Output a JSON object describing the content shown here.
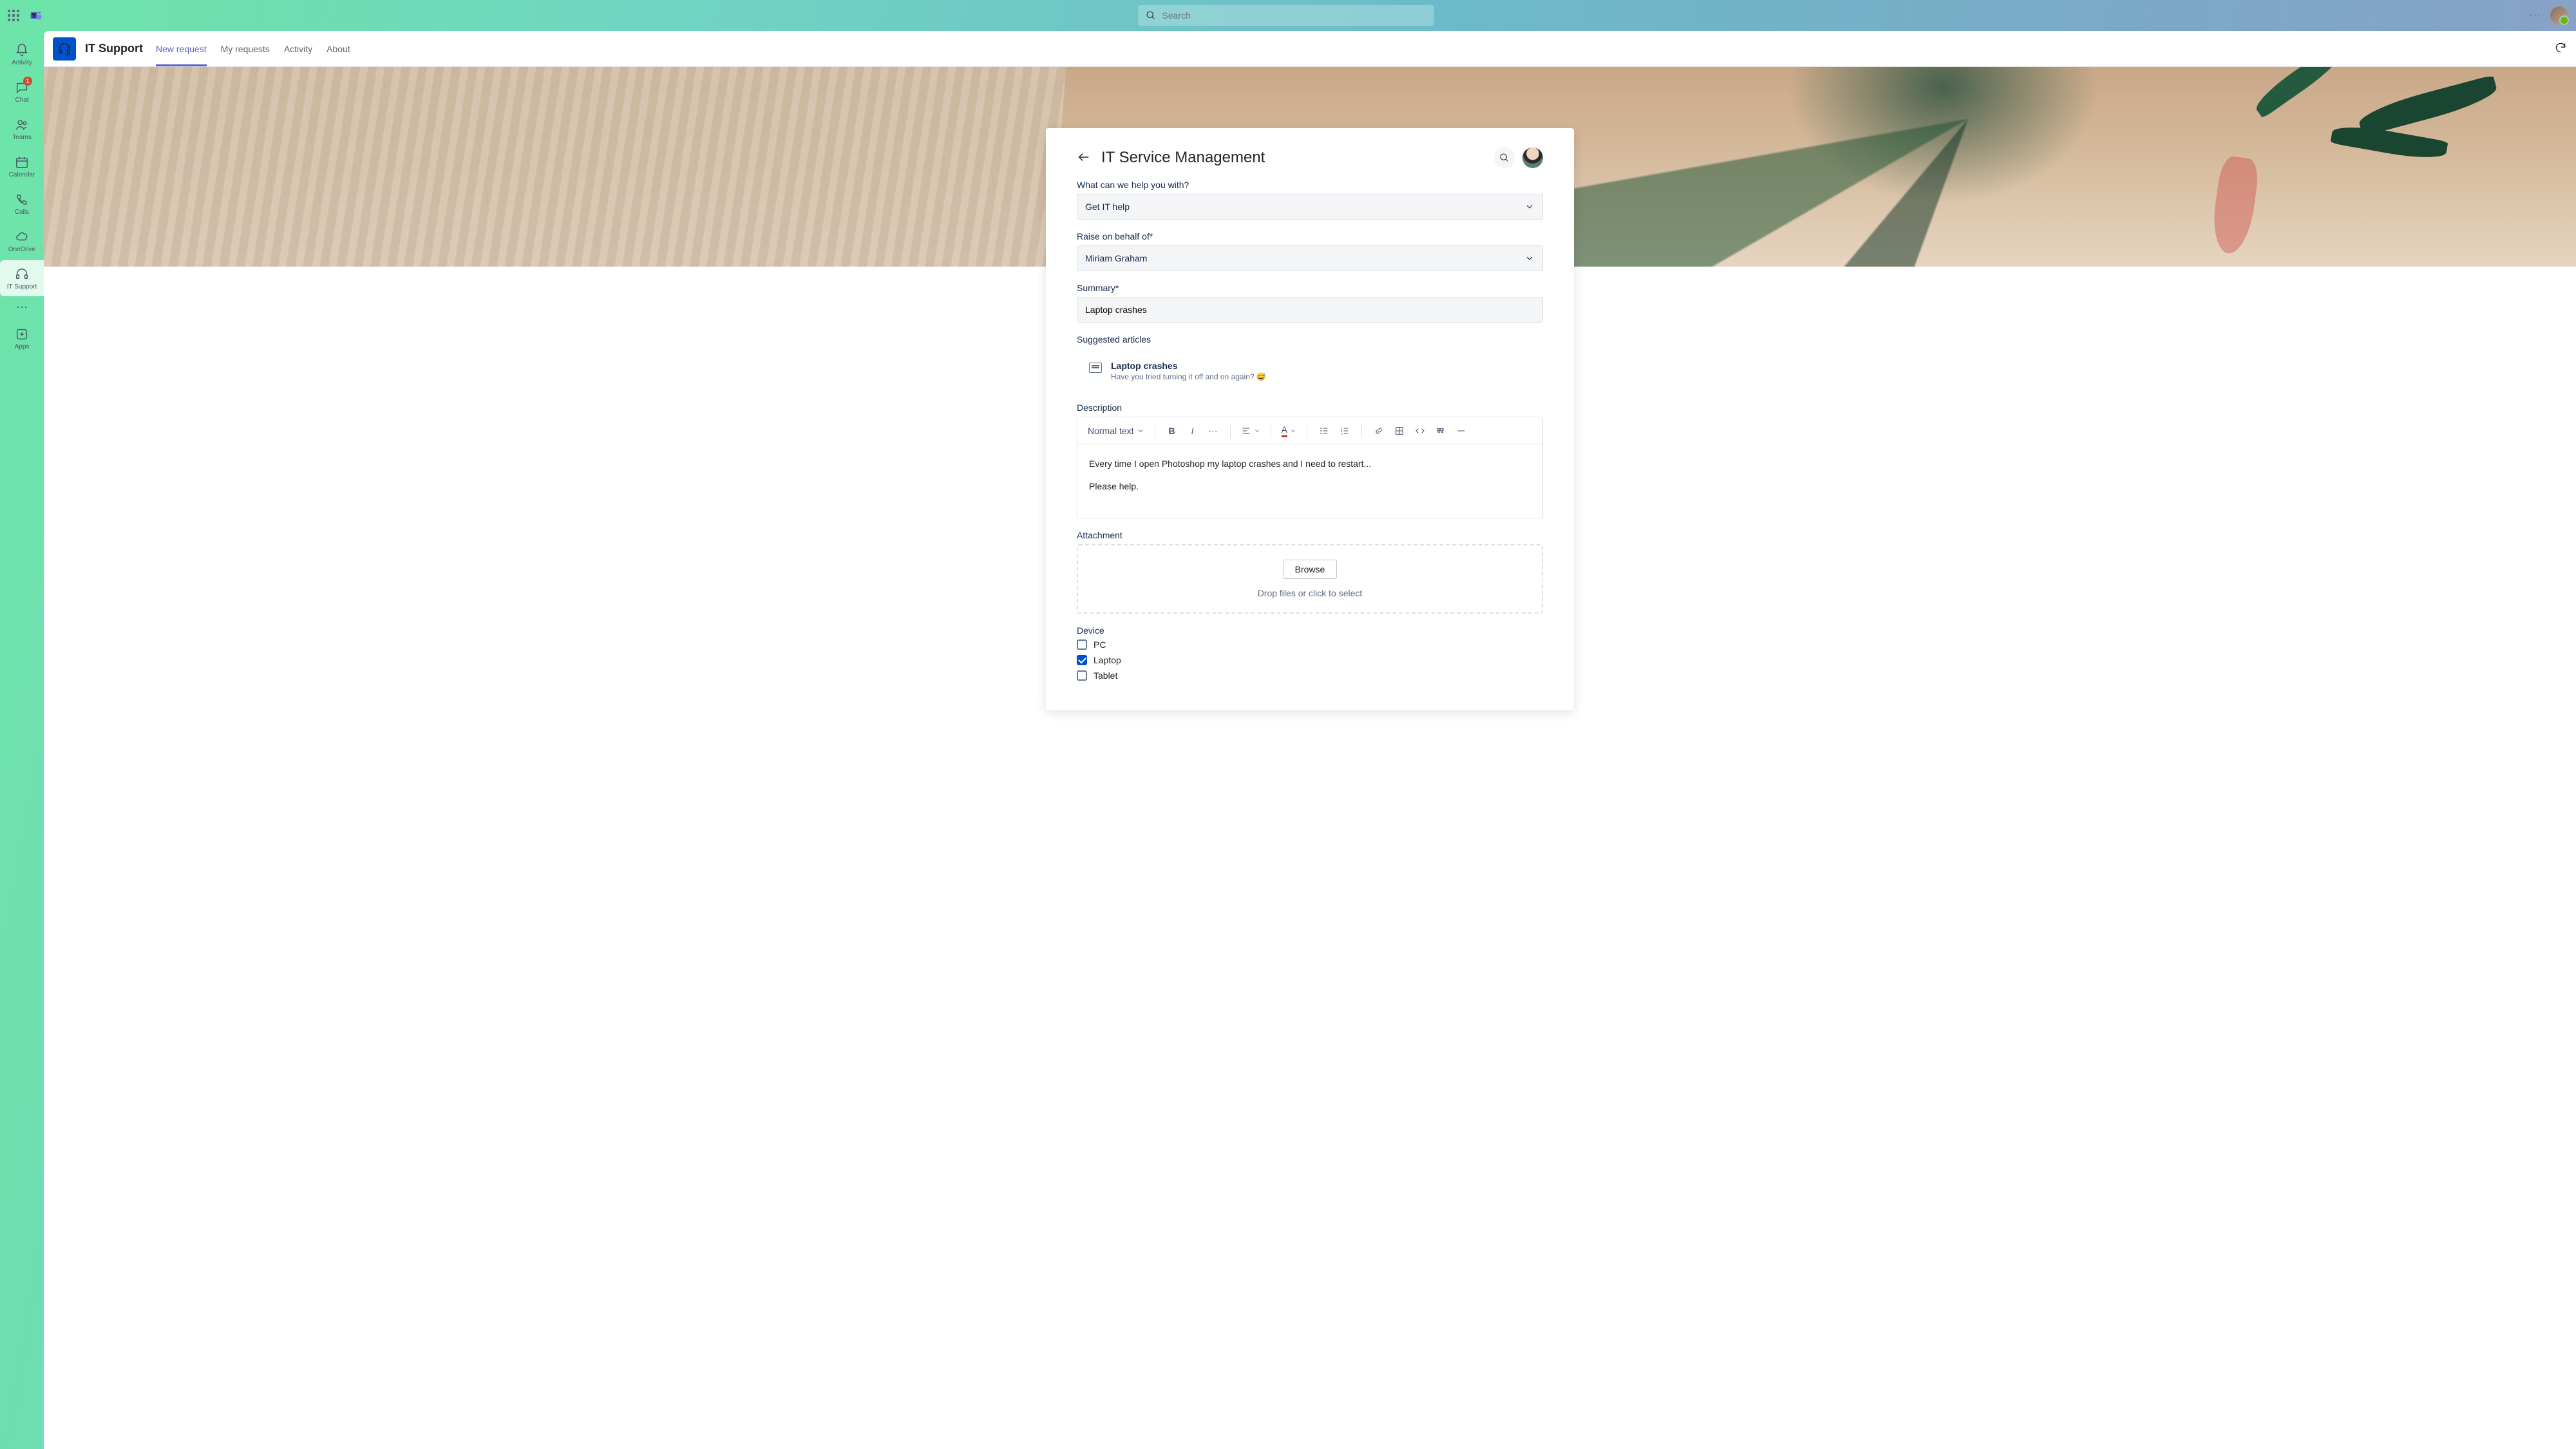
{
  "search": {
    "placeholder": "Search"
  },
  "rail": {
    "activity": "Activity",
    "chat": "Chat",
    "chat_badge": "1",
    "teams": "Teams",
    "calendar": "Calendar",
    "calls": "Calls",
    "onedrive": "OneDrive",
    "itsupport": "IT Support",
    "apps": "Apps"
  },
  "app": {
    "title": "IT Support",
    "tabs": {
      "new_request": "New request",
      "my_requests": "My requests",
      "activity": "Activity",
      "about": "About"
    }
  },
  "form": {
    "title": "IT Service Management",
    "help_label": "What can we help you with?",
    "help_value": "Get IT help",
    "behalf_label": "Raise on behalf of*",
    "behalf_value": "Miriam Graham",
    "summary_label": "Summary*",
    "summary_value": "Laptop crashes",
    "suggested_label": "Suggested articles",
    "article": {
      "title": "Laptop crashes",
      "subtitle": "Have you tried turning it off and on again? 😅"
    },
    "description_label": "Description",
    "rte_text_style": "Normal text",
    "description_p1": "Every time I open Photoshop my laptop crashes and I need to restart...",
    "description_p2": "Please help.",
    "attachment_label": "Attachment",
    "browse_label": "Browse",
    "drop_text": "Drop files or click to select",
    "device_label": "Device",
    "devices": {
      "pc": "PC",
      "laptop": "Laptop",
      "tablet": "Tablet"
    }
  }
}
